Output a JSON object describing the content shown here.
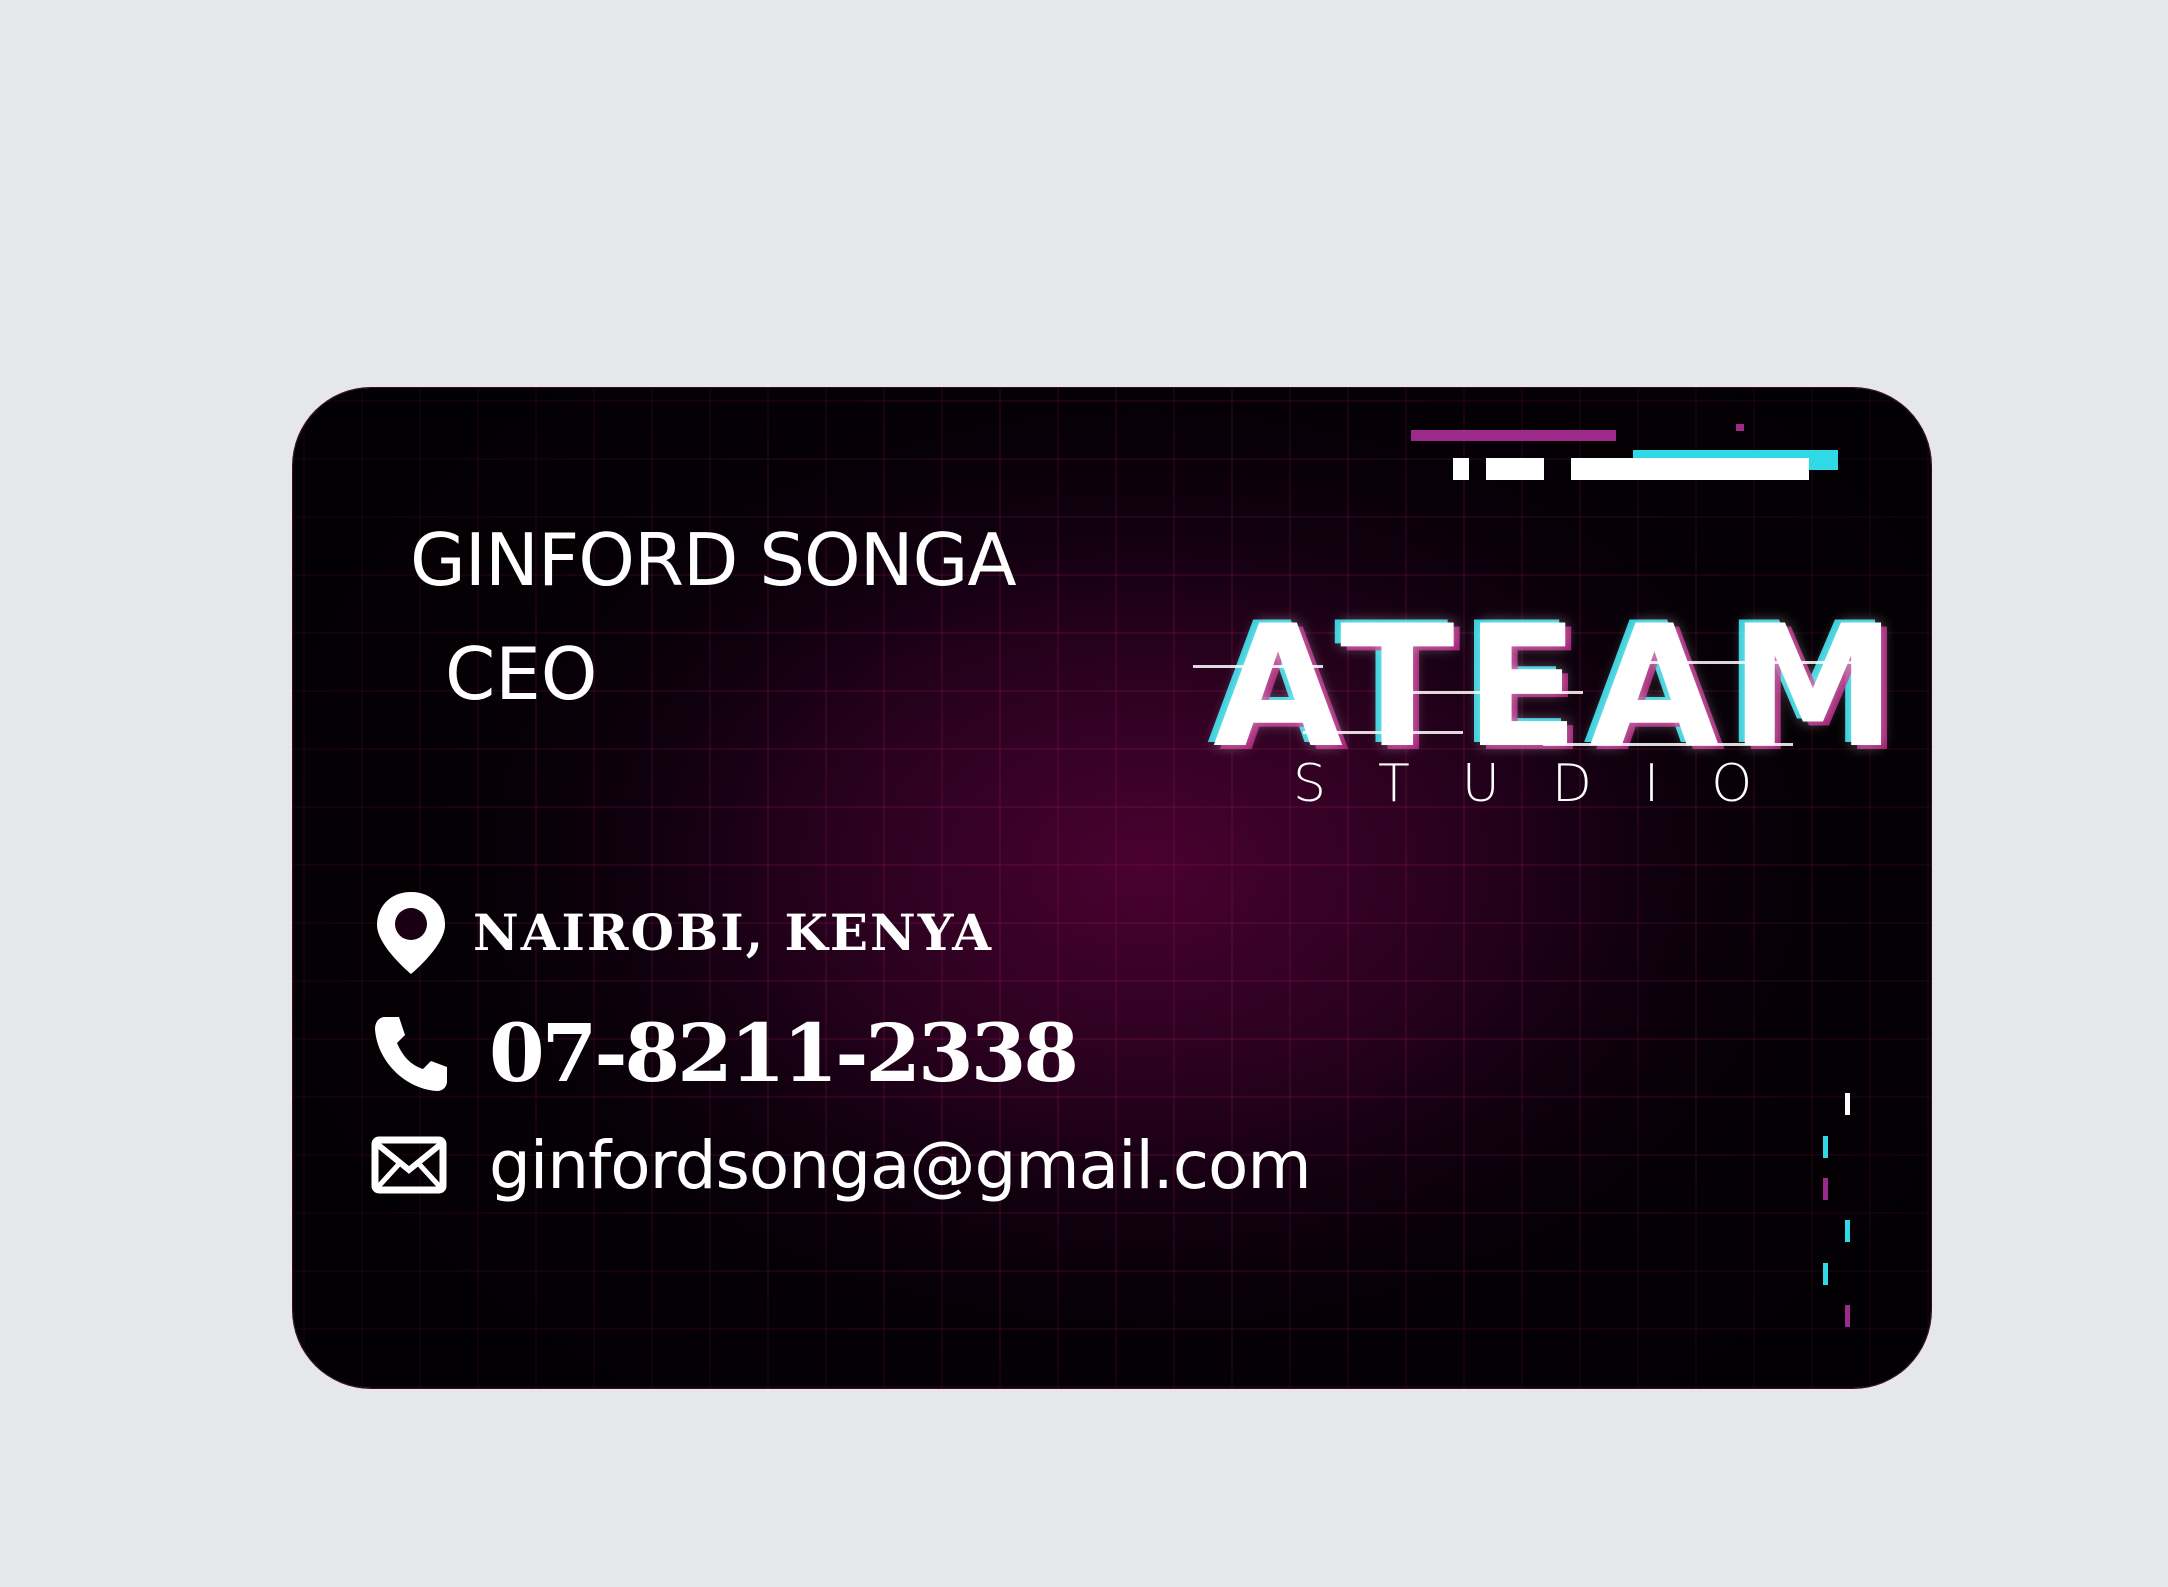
{
  "card": {
    "name": "GINFORD SONGA",
    "role": "CEO",
    "logo": {
      "word": "ATEAM",
      "subword": "STUDIO"
    },
    "contact": {
      "location": "NAIROBI, KENYA",
      "phone": "07-8211-2338",
      "email": "ginfordsonga@gmail.com"
    },
    "icons": {
      "location": "map-pin-icon",
      "phone": "phone-icon",
      "email": "envelope-icon"
    }
  },
  "colors": {
    "page_background": "#e6e7e9",
    "card_dark": "#070007",
    "card_glow": "#4a0130",
    "accent_cyan": "#2fd9e6",
    "accent_magenta": "#9b2a8a",
    "text": "#ffffff"
  }
}
